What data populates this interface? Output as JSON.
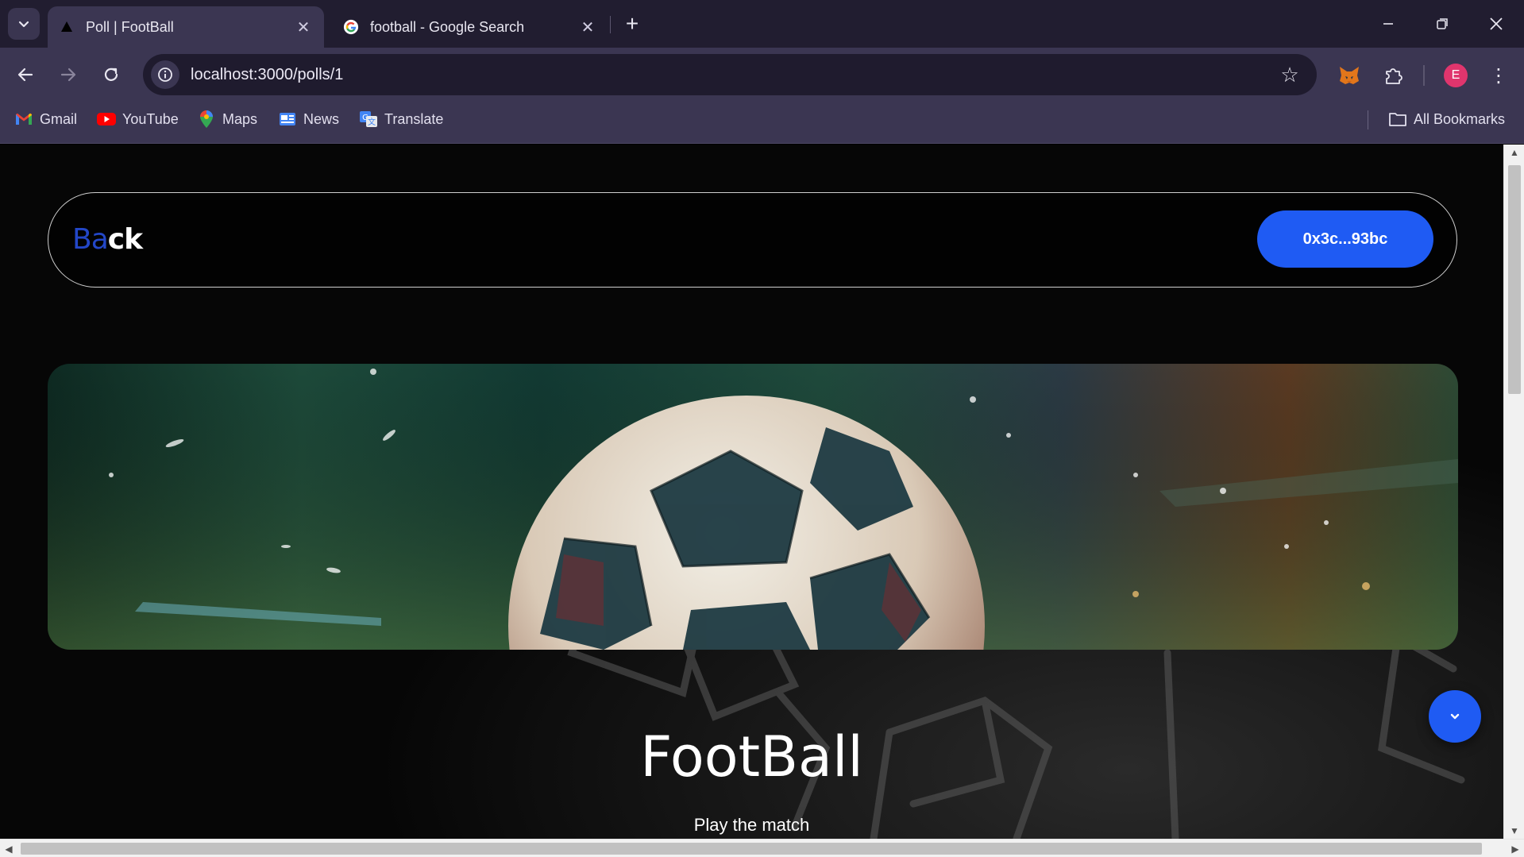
{
  "browser": {
    "tabs": [
      {
        "title": "Poll | FootBall",
        "active": true,
        "icon": "triangle-logo-icon"
      },
      {
        "title": "football - Google Search",
        "active": false,
        "icon": "google-icon"
      }
    ],
    "url": "localhost:3000/polls/1",
    "profile_initial": "E",
    "bookmarks": [
      {
        "label": "Gmail",
        "icon": "gmail-icon"
      },
      {
        "label": "YouTube",
        "icon": "youtube-icon"
      },
      {
        "label": "Maps",
        "icon": "maps-icon"
      },
      {
        "label": "News",
        "icon": "news-icon"
      },
      {
        "label": "Translate",
        "icon": "translate-icon"
      }
    ],
    "all_bookmarks_label": "All Bookmarks"
  },
  "page": {
    "back_part1": "Ba",
    "back_part2": "ck",
    "wallet_label": "0x3c...93bc",
    "poll_title": "FootBall",
    "poll_description": "Play the match"
  },
  "colors": {
    "accent": "#1f5bf3",
    "chrome_dark": "#211d30",
    "chrome": "#3b3652",
    "profile": "#e0356d"
  }
}
